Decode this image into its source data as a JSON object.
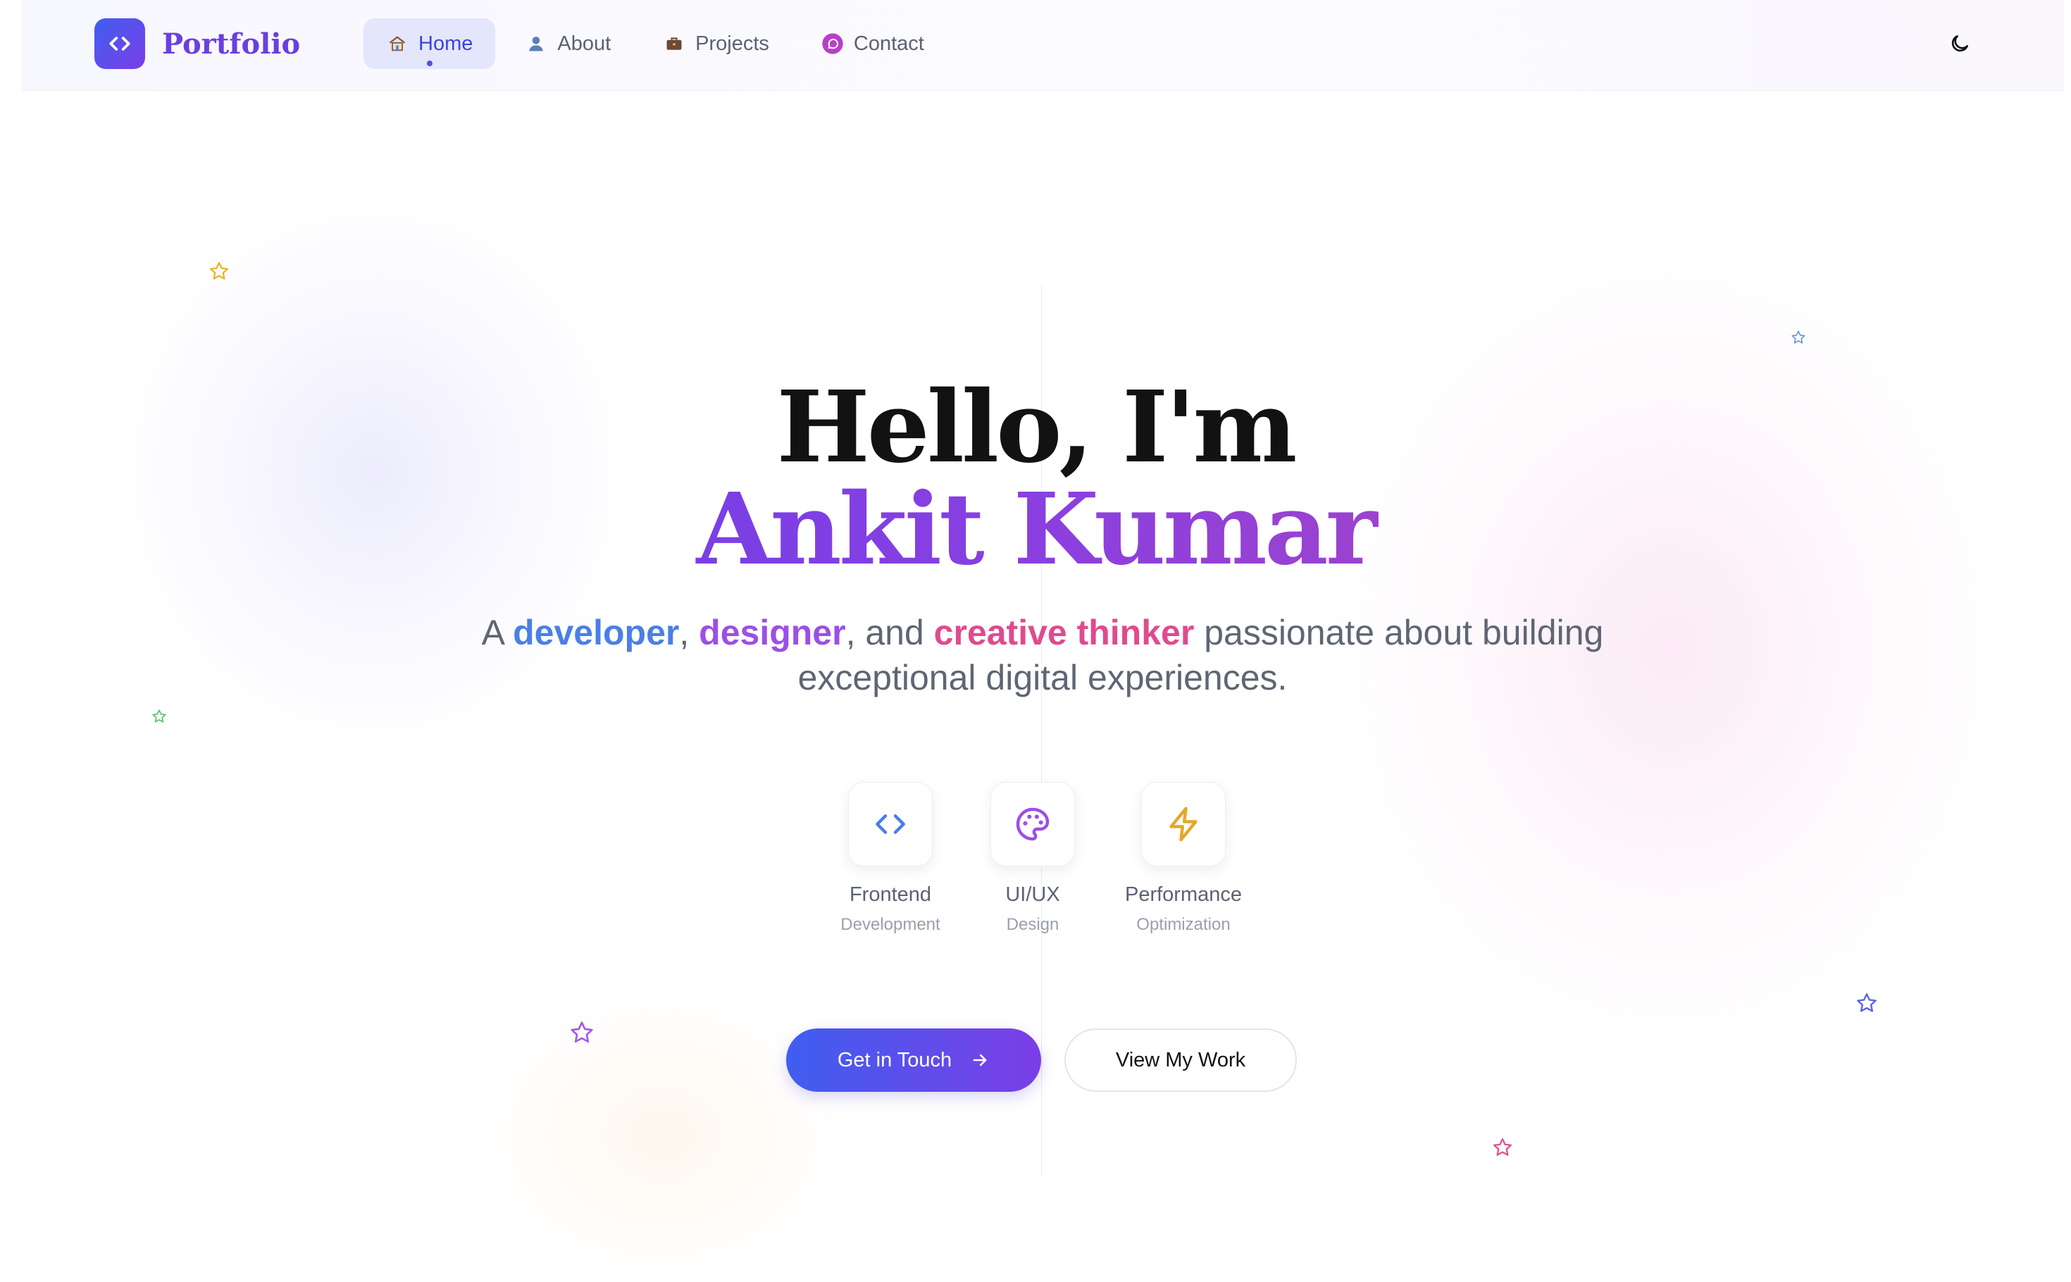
{
  "header": {
    "logo_text": "Portfolio",
    "nav": [
      {
        "label": "Home",
        "icon": "house-emoji-icon",
        "active": true
      },
      {
        "label": "About",
        "icon": "person-emoji-icon",
        "active": false
      },
      {
        "label": "Projects",
        "icon": "briefcase-emoji-icon",
        "active": false
      },
      {
        "label": "Contact",
        "icon": "chat-bubble-icon",
        "active": false
      }
    ],
    "theme_toggle_icon": "moon-icon"
  },
  "hero": {
    "greeting": "Hello, I'm",
    "name": "Ankit Kumar",
    "tagline": {
      "prefix": "A ",
      "w1": "developer",
      "sep1": ", ",
      "w2": "designer",
      "sep2": ", and ",
      "w3": "creative thinker",
      "rest": " passionate about building exceptional digital experiences."
    }
  },
  "skills": [
    {
      "title": "Frontend",
      "subtitle": "Development",
      "icon": "code-brackets-icon"
    },
    {
      "title": "UI/UX",
      "subtitle": "Design",
      "icon": "palette-icon"
    },
    {
      "title": "Performance",
      "subtitle": "Optimization",
      "icon": "lightning-bolt-icon"
    }
  ],
  "cta": {
    "primary": "Get in Touch",
    "secondary": "View My Work"
  },
  "colors": {
    "accent_blue": "#4a7fe6",
    "accent_purple": "#9c4fe6",
    "accent_pink": "#e04a8e",
    "gradient_start": "#3f5ef0",
    "gradient_end": "#7b3ee6"
  }
}
